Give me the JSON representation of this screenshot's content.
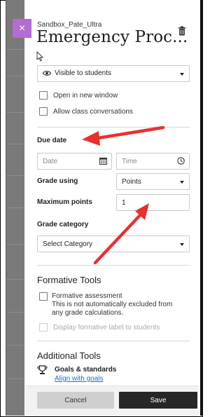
{
  "header": {
    "course_name": "Sandbox_Pate_Ultra",
    "title": "Emergency Proc...",
    "close_glyph": "×"
  },
  "visibility": {
    "selected": "Visible to students"
  },
  "options": {
    "open_new_window": "Open in new window",
    "allow_conversations": "Allow class conversations"
  },
  "due_date": {
    "label": "Due date",
    "date_placeholder": "Date",
    "time_placeholder": "Time"
  },
  "grade_using": {
    "label": "Grade using",
    "selected": "Points"
  },
  "max_points": {
    "label": "Maximum points",
    "value": "1"
  },
  "grade_category": {
    "label": "Grade category",
    "selected": "Select Category"
  },
  "formative": {
    "heading": "Formative Tools",
    "assessment_label": "Formative assessment",
    "assessment_note": "This is not automatically excluded from any grade calculations.",
    "display_label": "Display formative label to students"
  },
  "additional": {
    "heading": "Additional Tools",
    "goals_title": "Goals & standards",
    "goals_link": "Align with goals"
  },
  "footer": {
    "cancel": "Cancel",
    "save": "Save"
  },
  "colors": {
    "accent": "#b56bd4",
    "annotation_arrow": "#e8312f",
    "save_bg": "#262626",
    "link": "#1a6fc8"
  }
}
